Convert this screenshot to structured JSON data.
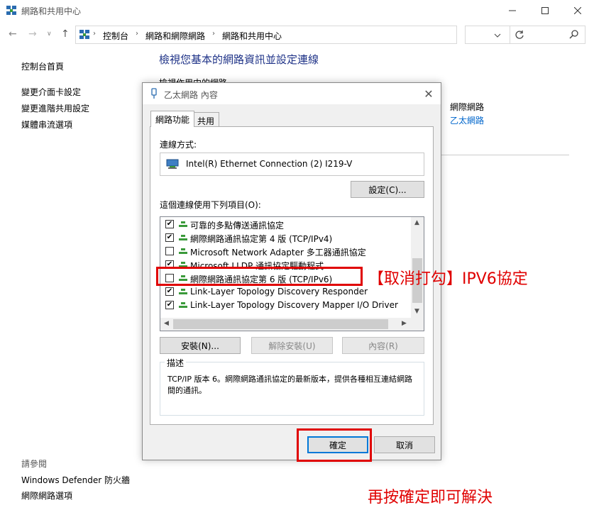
{
  "window": {
    "title": "網路和共用中心",
    "icons": {
      "app": "network-center-icon",
      "minimize": "minimize-icon",
      "maximize": "maximize-icon",
      "close": "close-icon"
    }
  },
  "address_bar": {
    "crumbs": [
      "控制台",
      "網路和網際網路",
      "網路和共用中心"
    ],
    "search_placeholder": ""
  },
  "left_pane": {
    "home": "控制台首頁",
    "links": [
      "變更介面卡設定",
      "變更進階共用設定",
      "媒體串流選項"
    ],
    "see_also_title": "請參閱",
    "see_also": [
      "Windows Defender 防火牆",
      "網際網路選項"
    ]
  },
  "main": {
    "title": "檢視您基本的網路資訊並設定連線",
    "section": "檢視作用中的網路",
    "access_type": "網際網路",
    "connection_link": "乙太網路"
  },
  "dialog": {
    "title": "乙太網路 內容",
    "tabs": [
      "網路功能",
      "共用"
    ],
    "connect_using_label": "連線方式:",
    "adapter_name": "Intel(R) Ethernet Connection (2) I219-V",
    "configure_button": "設定(C)...",
    "items_label": "這個連線使用下列項目(O):",
    "items": [
      {
        "label": "可靠的多點傳送通訊協定",
        "checked": true
      },
      {
        "label": "網際網路通訊協定第 4 版 (TCP/IPv4)",
        "checked": true
      },
      {
        "label": "Microsoft Network Adapter 多工器通訊協定",
        "checked": false
      },
      {
        "label": "Microsoft LLDP 通訊協定驅動程式",
        "checked": true
      },
      {
        "label": "網際網路通訊協定第 6 版 (TCP/IPv6)",
        "checked": false
      },
      {
        "label": "Link-Layer Topology Discovery Responder",
        "checked": true
      },
      {
        "label": "Link-Layer Topology Discovery Mapper I/O Driver",
        "checked": true
      }
    ],
    "install_button": "安裝(N)...",
    "uninstall_button": "解除安裝(U)",
    "properties_button": "內容(R)",
    "description_title": "描述",
    "description_text": "TCP/IP 版本 6。網際網路通訊協定的最新版本，提供各種相互連結網路間的通訊。",
    "ok_button": "確定",
    "cancel_button": "取消"
  },
  "annotations": {
    "ipv6_note": "【取消打勾】IPV6協定",
    "ok_note": "再按確定即可解決",
    "color": "#e00000"
  }
}
